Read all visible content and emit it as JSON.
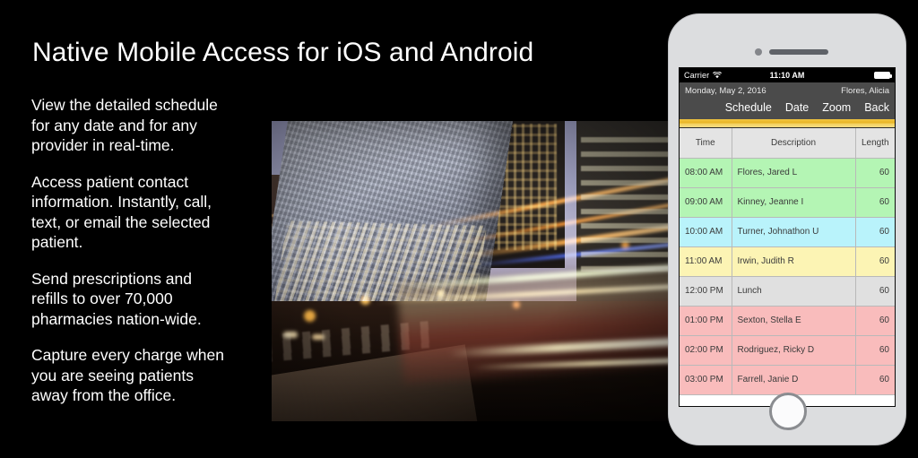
{
  "slide": {
    "title": "Native Mobile Access for iOS and Android",
    "background_color": "#000000",
    "bullets": [
      "View the detailed schedule\nfor any date and for any\nprovider in real-time.",
      "Access patient contact\ninformation.  Instantly, call,\ntext, or email the selected\npatient.",
      "Send prescriptions and\nrefills to over 70,000\npharmacies nation-wide.",
      "Capture every charge when\nyou are seeing patients\naway from the office."
    ]
  },
  "photo": {
    "alt": "Night city street with motion-blurred streetcar light trails and a glass office tower at dusk"
  },
  "phone": {
    "status_bar": {
      "carrier": "Carrier",
      "wifi_icon": "wifi-icon",
      "time": "11:10 AM",
      "battery_icon": "battery-full-icon"
    },
    "date_bar": {
      "date": "Monday, May 2, 2016",
      "provider": "Flores, Alicia"
    },
    "nav_buttons": [
      {
        "label": "Schedule",
        "name": "schedule-button"
      },
      {
        "label": "Date",
        "name": "date-button"
      },
      {
        "label": "Zoom",
        "name": "zoom-button"
      },
      {
        "label": "Back",
        "name": "back-button"
      }
    ],
    "accent_color": "#e8b424",
    "table": {
      "headers": {
        "time": "Time",
        "description": "Description",
        "length": "Length"
      },
      "rows": [
        {
          "time": "08:00 AM",
          "description": "Flores, Jared L",
          "length": "60",
          "color": "green",
          "color_hex": "#b4f5b4"
        },
        {
          "time": "09:00 AM",
          "description": "Kinney, Jeanne I",
          "length": "60",
          "color": "green",
          "color_hex": "#b4f5b4"
        },
        {
          "time": "10:00 AM",
          "description": "Turner, Johnathon U",
          "length": "60",
          "color": "cyan",
          "color_hex": "#b9f3fb"
        },
        {
          "time": "11:00 AM",
          "description": "Irwin, Judith R",
          "length": "60",
          "color": "yellow",
          "color_hex": "#fcf4b4"
        },
        {
          "time": "12:00 PM",
          "description": "Lunch",
          "length": "60",
          "color": "gray",
          "color_hex": "#e0e0e0"
        },
        {
          "time": "01:00 PM",
          "description": "Sexton, Stella E",
          "length": "60",
          "color": "pink",
          "color_hex": "#f9bcbc"
        },
        {
          "time": "02:00 PM",
          "description": "Rodriguez, Ricky D",
          "length": "60",
          "color": "pink",
          "color_hex": "#f9bcbc"
        },
        {
          "time": "03:00 PM",
          "description": "Farrell, Janie D",
          "length": "60",
          "color": "pink",
          "color_hex": "#f9bcbc"
        }
      ]
    }
  }
}
